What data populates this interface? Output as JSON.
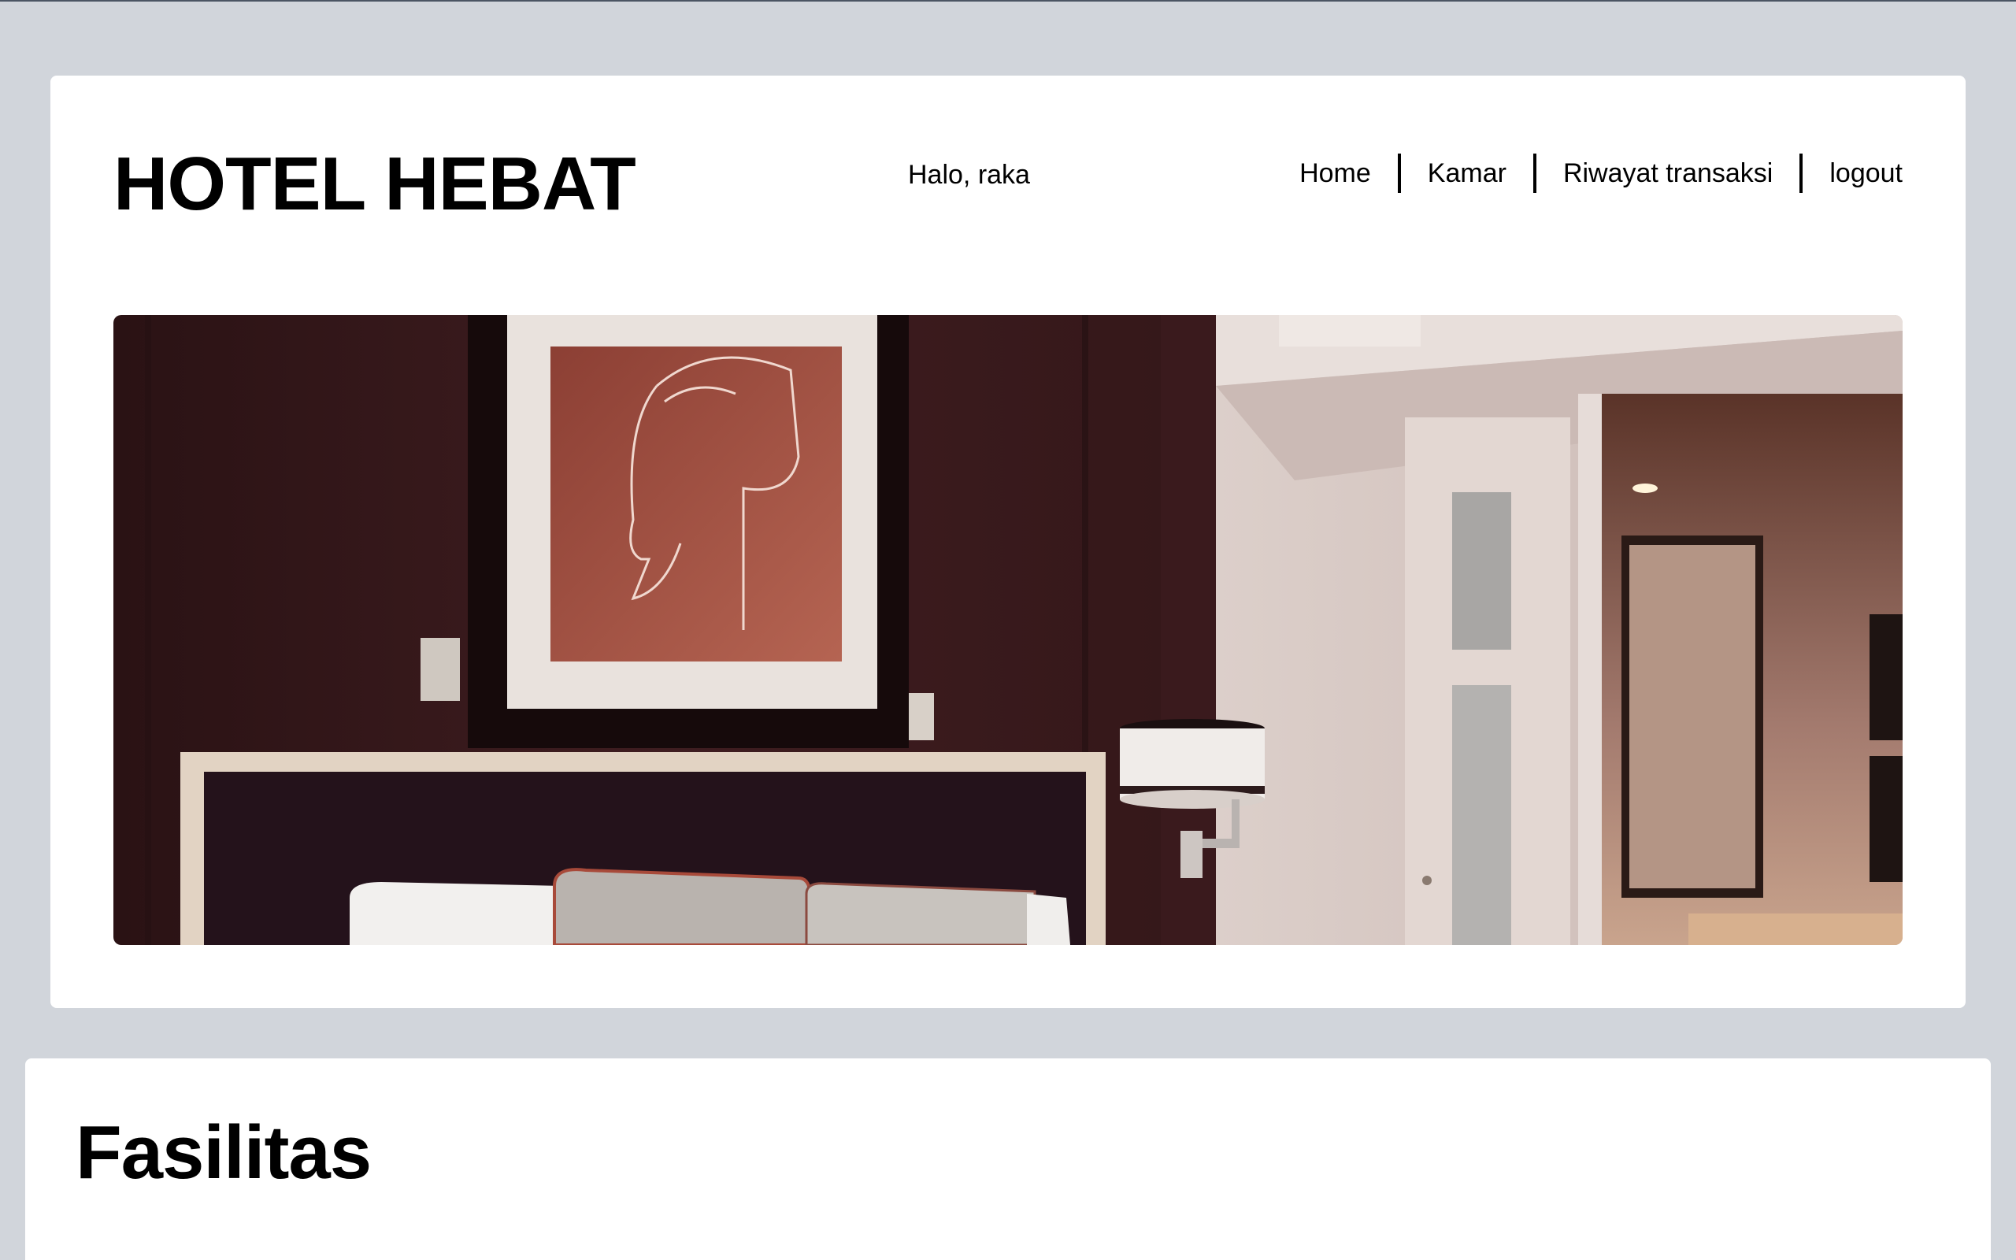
{
  "app": {
    "brand": "HOTEL HEBAT"
  },
  "header": {
    "greeting": "Halo, raka"
  },
  "nav": {
    "items": [
      {
        "label": "Home"
      },
      {
        "label": "Kamar"
      },
      {
        "label": "Riwayat transaksi"
      },
      {
        "label": "logout"
      }
    ]
  },
  "hero": {
    "image": "hotel-bedroom-photo"
  },
  "section": {
    "title": "Fasilitas"
  },
  "colors": {
    "background": "#d1d5db",
    "card": "#ffffff",
    "text": "#000000",
    "wall_dark": "#3d1c1e",
    "art_red": "#a4503f"
  }
}
